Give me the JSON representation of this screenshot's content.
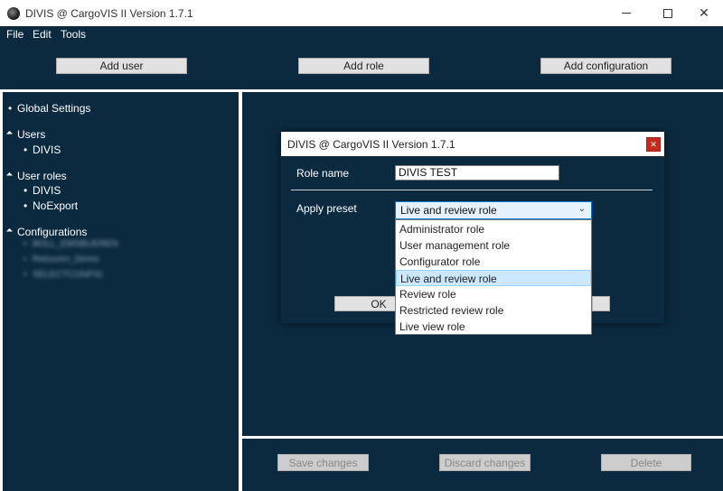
{
  "window": {
    "title": "DIVIS @ CargoVIS II Version 1.7.1",
    "min_icon": "minimize-icon",
    "max_icon": "maximize-icon",
    "close_glyph": "✕"
  },
  "menu": [
    "File",
    "Edit",
    "Tools"
  ],
  "toolbar": {
    "add_user": "Add user",
    "add_role": "Add role",
    "add_configuration": "Add configuration"
  },
  "tree": {
    "global_settings": "Global Settings",
    "users_header": "Users",
    "users": [
      "DIVIS"
    ],
    "roles_header": "User roles",
    "roles": [
      "DIVIS",
      "NoExport"
    ],
    "config_header": "Configurations",
    "configs": [
      "BOLL_EMSBUEREN",
      "Retouren_Demo",
      "SELECTCONFIG"
    ]
  },
  "bottom": {
    "save": "Save changes",
    "discard": "Discard changes",
    "delete": "Delete"
  },
  "dialog": {
    "title": "DIVIS @ CargoVIS II Version 1.7.1",
    "close_glyph": "✕",
    "role_name_label": "Role name",
    "role_name_value": "DIVIS TEST",
    "apply_preset_label": "Apply preset",
    "selected_preset": "Live and review role",
    "ok_label": "OK",
    "presets": [
      "Administrator role",
      "User management role",
      "Configurator role",
      "Live and review role",
      "Review role",
      "Restricted review role",
      "Live view role"
    ],
    "selected_index": 3
  },
  "colors": {
    "background": "#0b2a40",
    "close_red": "#c42b1c",
    "selection": "#cce8ff"
  }
}
